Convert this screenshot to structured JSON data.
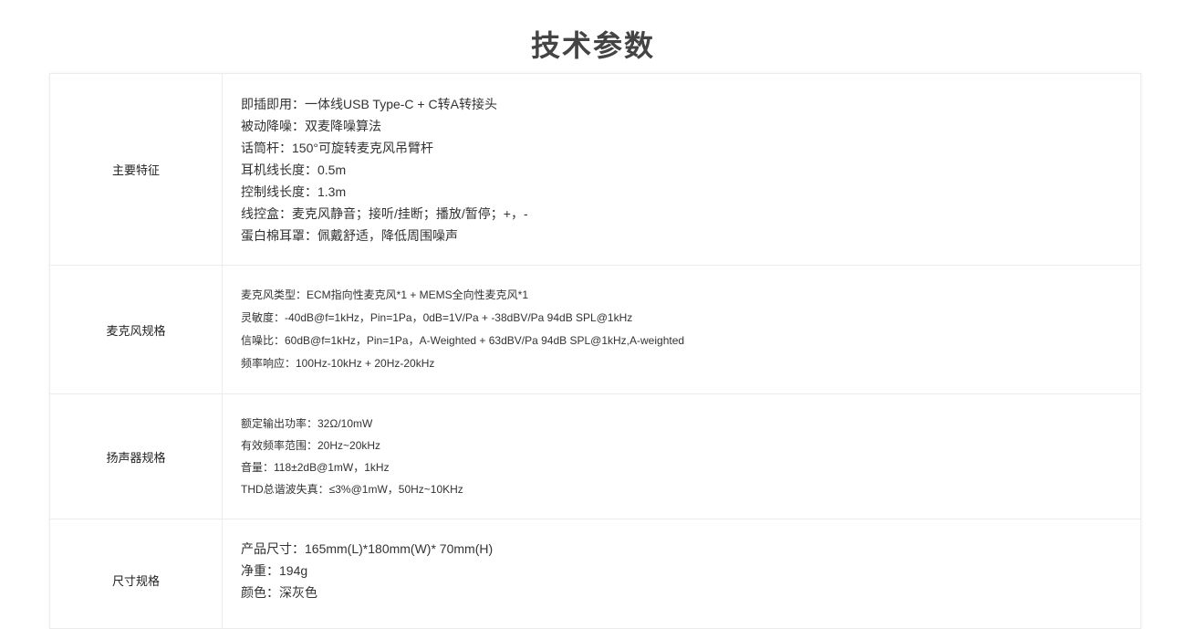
{
  "page": {
    "title": "技术参数"
  },
  "specs": [
    {
      "label": "主要特征",
      "lines": [
        "即插即用：一体线USB Type-C + C转A转接头",
        "被动降噪：双麦降噪算法",
        "话筒杆：150°可旋转麦克风吊臂杆",
        "耳机线长度：0.5m",
        "控制线长度：1.3m",
        "线控盒：麦克风静音；接听/挂断；播放/暂停；+，-",
        "蛋白棉耳罩：佩戴舒适，降低周围噪声"
      ]
    },
    {
      "label": "麦克风规格",
      "lines": [
        "麦克风类型：ECM指向性麦克风*1 + MEMS全向性麦克风*1",
        "灵敏度：-40dB@f=1kHz，Pin=1Pa，0dB=1V/Pa + -38dBV/Pa 94dB SPL@1kHz",
        "信噪比：60dB@f=1kHz，Pin=1Pa，A-Weighted + 63dBV/Pa 94dB SPL@1kHz,A-weighted",
        "频率响应：100Hz-10kHz + 20Hz-20kHz"
      ]
    },
    {
      "label": "扬声器规格",
      "lines": [
        "额定输出功率：32Ω/10mW",
        "有效频率范围：20Hz~20kHz",
        "音量：118±2dB@1mW，1kHz",
        "THD总谐波失真：≤3%@1mW，50Hz~10KHz"
      ]
    },
    {
      "label": "尺寸规格",
      "lines": [
        "产品尺寸：165mm(L)*180mm(W)* 70mm(H)",
        "净重：194g",
        "颜色：深灰色"
      ]
    }
  ]
}
